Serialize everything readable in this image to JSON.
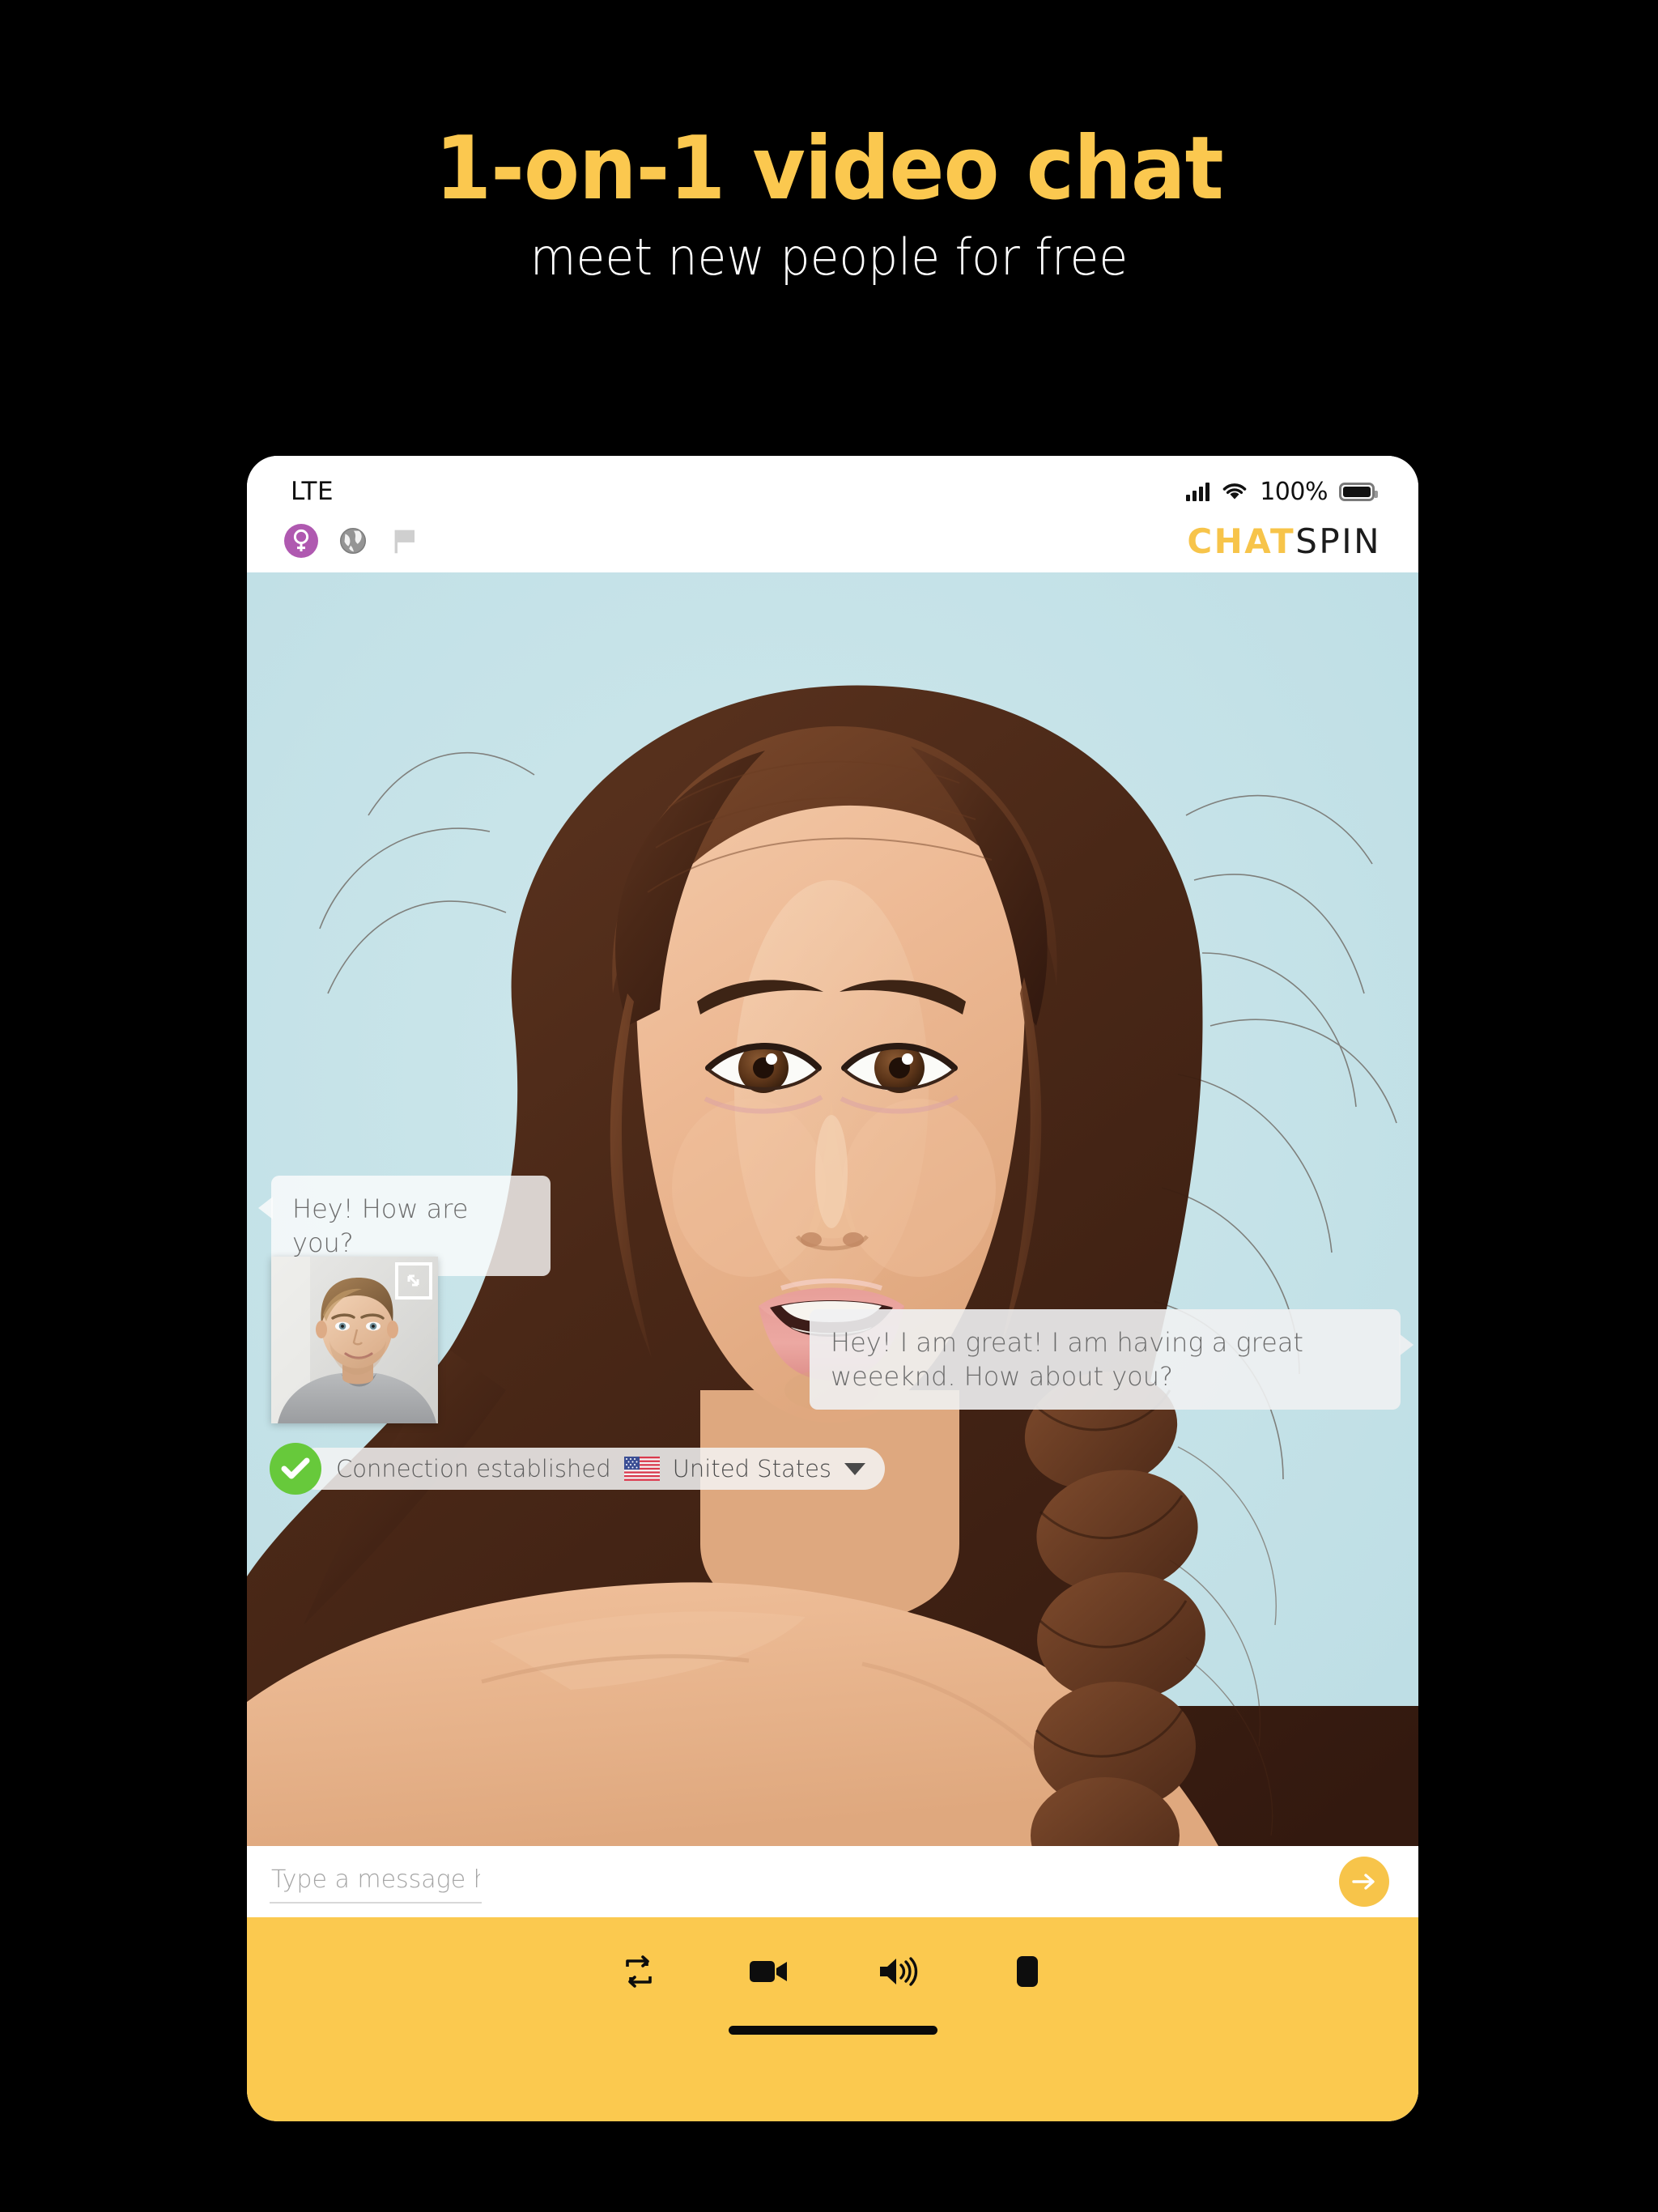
{
  "promo": {
    "title": "1-on-1 video chat",
    "subtitle": "meet new people for free",
    "title_color": "#FBC84F",
    "subtitle_color": "#FFFFFF",
    "background_color": "#000000"
  },
  "device": {
    "status_bar": {
      "network": "LTE",
      "battery_percent": "100%",
      "icons": [
        "signal-bars-icon",
        "wifi-icon",
        "battery-icon"
      ]
    },
    "app_bar": {
      "icons": [
        {
          "name": "gender-filter-icon",
          "glyph": "venus",
          "color": "#AF59B0"
        },
        {
          "name": "globe-region-icon",
          "glyph": "globe",
          "color": "#8E8E8E"
        },
        {
          "name": "flag-icon",
          "glyph": "flag",
          "color": "#C9C9C9"
        }
      ],
      "brand_part1": "CHAT",
      "brand_part2": "SPIN",
      "brand_color_1": "#F7C44A",
      "brand_color_2": "#1C1C1C"
    },
    "video": {
      "remote_label": "remote-video-feed",
      "background_color": "#C5E2E8",
      "self_view_label": "self-video-thumbnail",
      "expand_icon": "expand-fullscreen-icon"
    },
    "messages": [
      {
        "side": "left",
        "text": "Hey! How are you?"
      },
      {
        "side": "right",
        "text": "Hey! I am great! I am having a great weeeknd. How about you?"
      }
    ],
    "connection": {
      "status_text": "Connection established",
      "status_icon": "check-circle-icon",
      "status_color": "#67C93B",
      "country": "United States",
      "flag_icon": "us-flag-icon",
      "dropdown_icon": "chevron-down-icon"
    },
    "composer": {
      "placeholder": "Type a message here",
      "value": "",
      "send_icon": "arrow-right-icon",
      "send_color": "#F7C44A"
    },
    "toolbar": {
      "background_color": "#FBC94F",
      "buttons": [
        {
          "name": "next-partner-button",
          "icon": "repeat-icon"
        },
        {
          "name": "camera-toggle-button",
          "icon": "video-camera-icon"
        },
        {
          "name": "volume-button",
          "icon": "speaker-volume-icon"
        },
        {
          "name": "stop-button",
          "icon": "stop-square-icon"
        }
      ]
    },
    "home_indicator": "home-indicator-bar"
  }
}
